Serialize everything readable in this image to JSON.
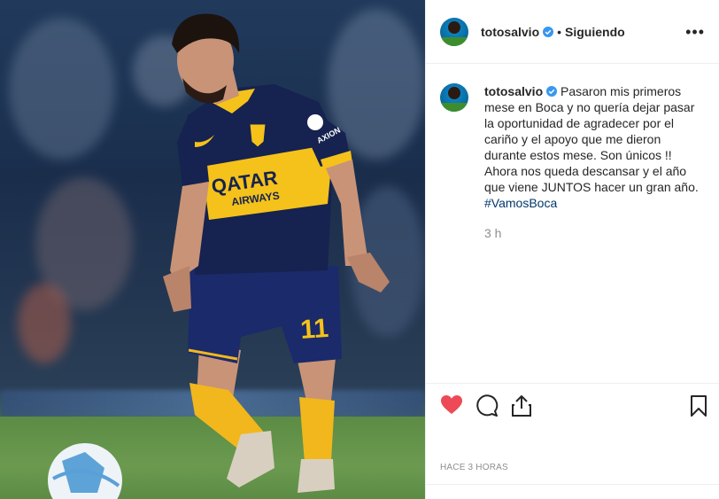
{
  "post": {
    "username": "totosalvio",
    "separator": "•",
    "follow_status": "Siguiendo",
    "more_label": "•••",
    "caption": "Pasaron mis primeros mese en Boca y no quería dejar pasar la oportunidad de agradecer por el cariño y el apoyo que me dieron durante estos mese. Son únicos !! Ahora nos queda descansar y el año que viene JUNTOS hacer un gran año.",
    "hashtag": "#VamosBoca",
    "relative_time": "3 h",
    "timestamp_label": "HACE 3 HORAS"
  },
  "photo": {
    "jersey_sponsor_line1": "QATAR",
    "jersey_sponsor_line2": "AIRWAYS",
    "jersey_number": "11",
    "sleeve_brand": "AXION"
  },
  "icons": {
    "verified": "verified-badge-icon",
    "like": "heart-icon",
    "comment": "comment-icon",
    "share": "share-icon",
    "save": "bookmark-icon",
    "more": "more-options-icon"
  },
  "colors": {
    "like_red": "#ed4956",
    "verified_blue": "#3897f0",
    "hashtag_blue": "#00376b",
    "muted_text": "#8e8e8e",
    "jersey_navy": "#16224f",
    "jersey_yellow": "#f4c21a"
  }
}
